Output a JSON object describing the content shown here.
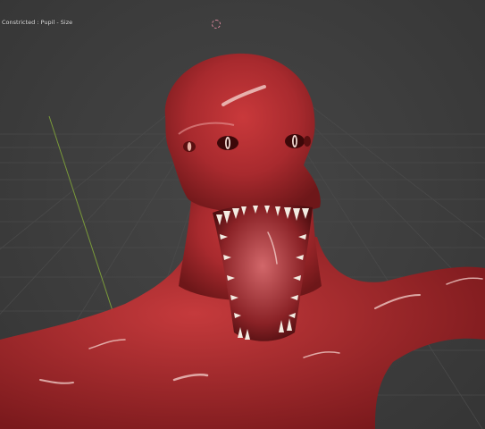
{
  "viewport": {
    "mode_overlay": "Constricted : Pupil - Size",
    "cursor_icon": "brush-circle-icon"
  },
  "scene": {
    "object_icon": "creature-mesh-icon",
    "colors": {
      "background": "#3d3d3d",
      "grid_line": "#4a4a4a",
      "y_axis": "#7a9a3a",
      "skin_base": "#b02a2f",
      "skin_highlight": "#f5d4cf",
      "teeth": "#f3ece2"
    }
  }
}
